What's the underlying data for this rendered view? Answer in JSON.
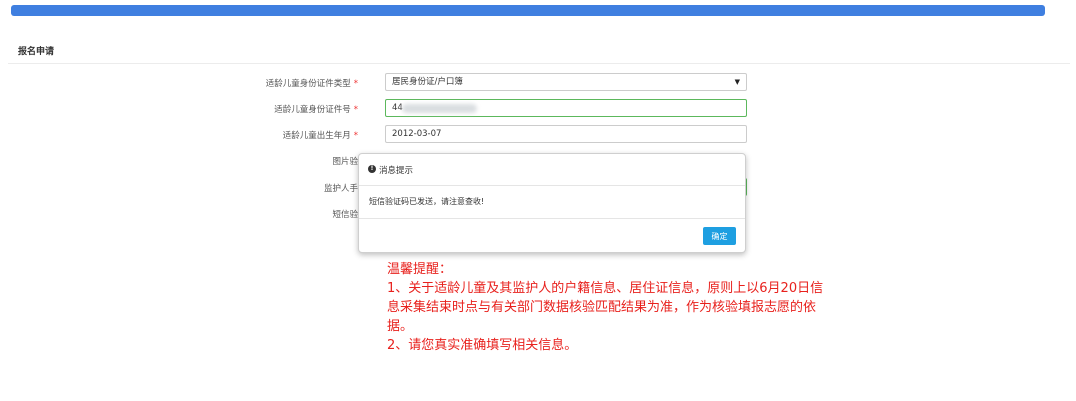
{
  "header": {
    "title": "报名申请"
  },
  "form": {
    "rows": [
      {
        "label": "适龄儿童身份证件类型",
        "required": "*",
        "value": "居民身份证/户口簿"
      },
      {
        "label": "适龄儿童身份证件号",
        "required": "*",
        "value": "44"
      },
      {
        "label": "适龄儿童出生年月",
        "required": "*",
        "value": "2012-03-07"
      },
      {
        "label": "图片验"
      },
      {
        "label": "监护人手"
      },
      {
        "label": "短信验"
      }
    ]
  },
  "modal": {
    "icon": "info-circle-icon",
    "title": "消息提示",
    "message": "短信验证码已发送，请注意查收!",
    "ok_label": "确定"
  },
  "reminder": {
    "title": "温馨提醒：",
    "line1": "1、关于适龄儿童及其监护人的户籍信息、居住证信息，原则上以6月20日信",
    "line2": "息采集结束时点与有关部门数据核验匹配结果为准，作为核验填报志愿的依",
    "line3": "据。",
    "line4": "2、请您真实准确填写相关信息。"
  },
  "colors": {
    "accent": "#3f7fe0",
    "button": "#1e9fe1",
    "warning": "#e8211d",
    "valid": "#5cb85c"
  }
}
